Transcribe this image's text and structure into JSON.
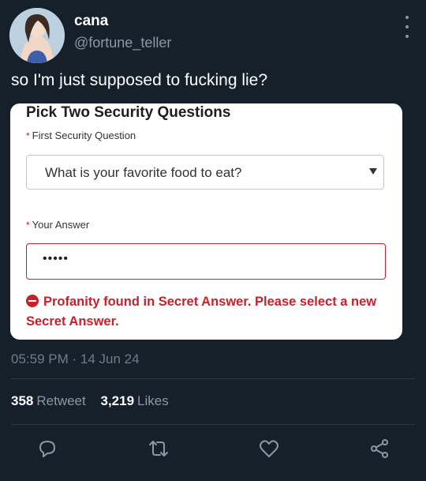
{
  "user": {
    "display_name": "cana",
    "handle": "@fortune_teller"
  },
  "tweet": {
    "text": "so I'm just supposed to fucking lie?",
    "timestamp": "05:59 PM · 14 Jun 24"
  },
  "embed": {
    "title": "Pick Two Security Questions",
    "first_question_label": "First Security Question",
    "required_marker": "*",
    "selected_question": "What is your favorite food to eat?",
    "answer_label": "Your Answer",
    "answer_value": "•••••",
    "error_message": "Profanity found in Secret Answer. Please select a new Secret Answer."
  },
  "stats": {
    "retweets_count": "358",
    "retweets_label": "Retweet",
    "likes_count": "3,219",
    "likes_label": "Likes"
  },
  "icons": {
    "reply": "reply-icon",
    "retweet": "retweet-icon",
    "like": "heart-icon",
    "share": "share-icon",
    "more": "more-icon"
  },
  "colors": {
    "background": "#16202b",
    "error": "#c8202c",
    "muted": "#8b98a5"
  }
}
